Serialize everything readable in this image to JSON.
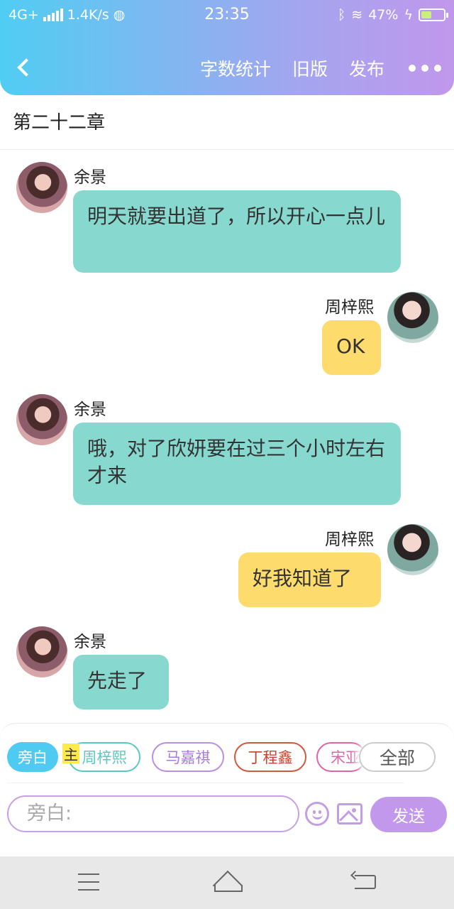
{
  "status_bar": {
    "network": "4G+",
    "speed": "1.4K/s",
    "time": "23:35",
    "battery_percent": "47%",
    "battery_level": 0.47
  },
  "header": {
    "back_icon": "chevron-left-icon",
    "actions": [
      "字数统计",
      "旧版",
      "发布"
    ],
    "more_icon": "more-dots-icon"
  },
  "chapter_title": "第二十二章",
  "messages": [
    {
      "side": "left",
      "sender": "余景",
      "text": "明天就要出道了，所以开心一点儿"
    },
    {
      "side": "right",
      "sender": "周梓熙",
      "text": "OK"
    },
    {
      "side": "left",
      "sender": "余景",
      "text": "哦，对了欣妍要在过三个小时左右才来"
    },
    {
      "side": "right",
      "sender": "周梓熙",
      "text": "好我知道了"
    },
    {
      "side": "left",
      "sender": "余景",
      "text": "先走了"
    }
  ],
  "composer": {
    "role_chips": [
      "旁白",
      "周梓熙",
      "马嘉祺",
      "丁程鑫",
      "宋亚"
    ],
    "main_mark": "主",
    "all_label": "全部",
    "input_placeholder": "旁白:",
    "send_label": "发送"
  },
  "colors": {
    "left_bubble": "#87d9d0",
    "right_bubble": "#fddb6d",
    "accent": "#c198ec"
  }
}
